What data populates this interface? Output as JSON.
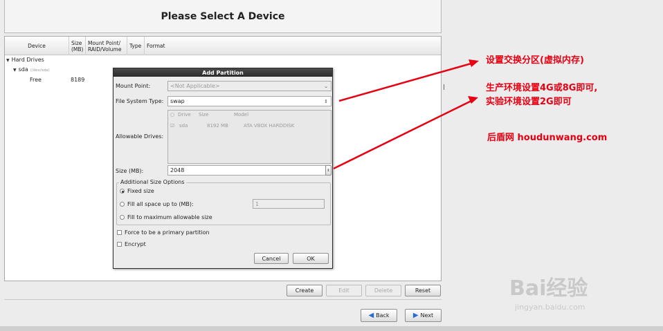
{
  "header": {
    "title": "Please Select A Device"
  },
  "device_table": {
    "columns": [
      "Device",
      "Size\n(MB)",
      "Mount Point/\nRAID/Volume",
      "Type",
      "Format"
    ],
    "group": "Hard Drives",
    "disk": {
      "name": "sda",
      "path": "(/dev/sda)"
    },
    "free_row": {
      "label": "Free",
      "size": "8189"
    }
  },
  "action_buttons": {
    "create": "Create",
    "edit": "Edit",
    "delete": "Delete",
    "reset": "Reset"
  },
  "nav_buttons": {
    "back": "Back",
    "next": "Next"
  },
  "dialog": {
    "title": "Add Partition",
    "mount_point": {
      "label": "Mount Point:",
      "value": "<Not Applicable>"
    },
    "fs_type": {
      "label": "File System Type:",
      "value": "swap"
    },
    "allowable_drives": {
      "label": "Allowable Drives:",
      "headers": [
        "Drive",
        "Size",
        "Model"
      ],
      "row": {
        "drive": "sda",
        "size": "8192 MB",
        "model": "ATA VBOX HARDDISK"
      }
    },
    "size": {
      "label": "Size (MB):",
      "value": "2048"
    },
    "size_options": {
      "legend": "Additional Size Options",
      "fixed": "Fixed size",
      "fill_upto": "Fill all space up to (MB):",
      "fill_upto_value": "1",
      "fill_max": "Fill to maximum allowable size"
    },
    "force_primary": "Force to be a primary partition",
    "encrypt": "Encrypt",
    "cancel": "Cancel",
    "ok": "OK"
  },
  "annotations": {
    "swap_note": "设置交换分区(虚拟内存)",
    "size_note_line1": "生产环境设置4G或8G即可,",
    "size_note_line2": "实验环境设置2G即可",
    "site_note": "后盾网 houdunwang.com",
    "color": "#e60012"
  },
  "watermark": {
    "brand": "Bai经验",
    "url": "jingyan.baidu.com"
  }
}
